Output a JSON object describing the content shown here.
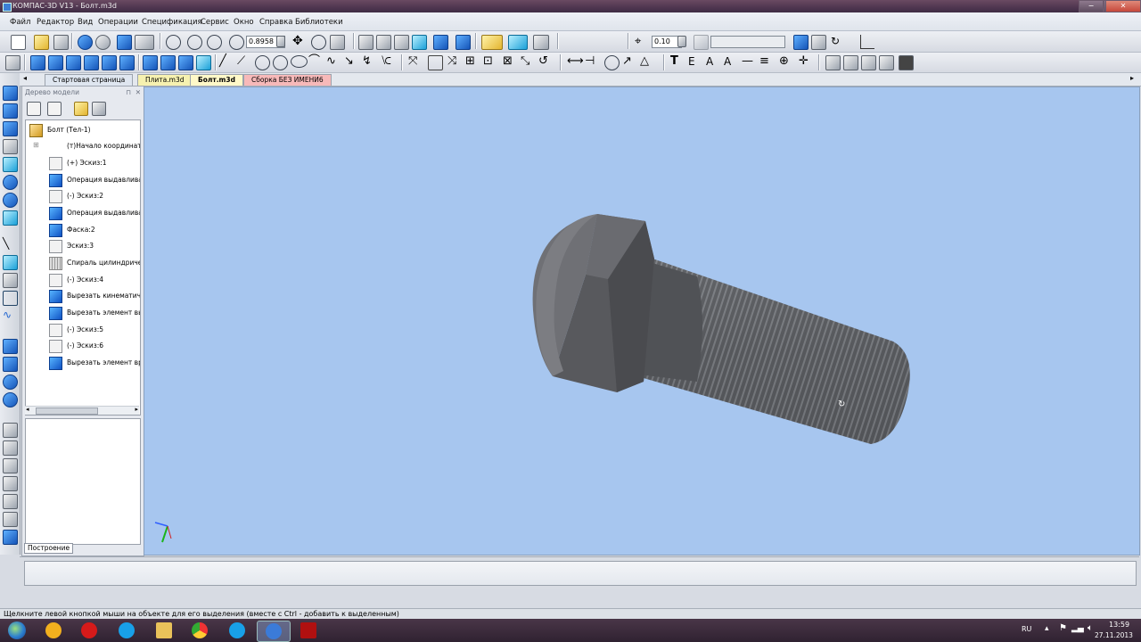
{
  "window": {
    "title": "КОМПАС-3D V13 - Болт.m3d",
    "controls": [
      "−",
      "□",
      "✕"
    ]
  },
  "menu": [
    "Файл",
    "Редактор",
    "Вид",
    "Операции",
    "Спецификация",
    "Сервис",
    "Окно",
    "Справка",
    "Библиотеки"
  ],
  "toolbar": {
    "zoom_value": "0.8958",
    "step_value": "0.10"
  },
  "tabs": [
    {
      "label": "Стартовая страница",
      "color": "#dfe6f0"
    },
    {
      "label": "Плита.m3d",
      "color": "#f6f1b0"
    },
    {
      "label": "Болт.m3d",
      "color": "#fff8c8"
    },
    {
      "label": "Сборка БЕЗ ИМЕНИ6",
      "color": "#f7b9b9"
    }
  ],
  "tree": {
    "title": "Дерево модели",
    "pin": "⊓",
    "close": "✕",
    "root": "Болт (Тел-1)",
    "items": [
      {
        "label": "(т)Начало координат",
        "icon": "origin-icon"
      },
      {
        "label": "(+) Эскиз:1",
        "icon": "sketch-icon"
      },
      {
        "label": "Операция выдавлива",
        "icon": "extrude-icon"
      },
      {
        "label": "(-) Эскиз:2",
        "icon": "sketch-icon"
      },
      {
        "label": "Операция выдавлива",
        "icon": "extrude-icon"
      },
      {
        "label": "Фаска:2",
        "icon": "chamfer-icon"
      },
      {
        "label": "Эскиз:3",
        "icon": "sketch-icon"
      },
      {
        "label": "Спираль цилиндриче",
        "icon": "spiral-icon"
      },
      {
        "label": "(-) Эскиз:4",
        "icon": "sketch-icon"
      },
      {
        "label": "Вырезать кинематиче",
        "icon": "cut-kinematic-icon"
      },
      {
        "label": "Вырезать элемент вы",
        "icon": "cut-extrude-icon"
      },
      {
        "label": "(-) Эскиз:5",
        "icon": "sketch-icon"
      },
      {
        "label": "(-) Эскиз:6",
        "icon": "sketch-icon"
      },
      {
        "label": "Вырезать элемент вра",
        "icon": "cut-revolve-icon"
      }
    ],
    "bottom_tab": "Построение"
  },
  "status": {
    "hint": "Щелкните левой кнопкой мыши на объекте для его выделения (вместе с Ctrl - добавить к выделенным)"
  },
  "taskbar": {
    "language": "RU",
    "time": "13:59",
    "date": "27.11.2013"
  },
  "colors": {
    "viewport_bg": "#a7c6ef",
    "accent_blue": "#1f64d0"
  }
}
